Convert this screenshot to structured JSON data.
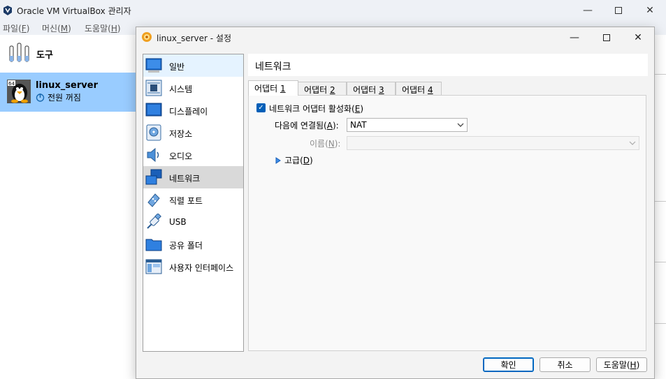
{
  "main_window": {
    "title": "Oracle VM VirtualBox 관리자",
    "menu": [
      "파일",
      "머신",
      "도움말"
    ],
    "menu_keys": [
      "F",
      "M",
      "H"
    ]
  },
  "left_pane": {
    "tools_label": "도구",
    "vm": {
      "name": "linux_server",
      "status": "전원 꺼짐",
      "badge": "64"
    }
  },
  "dialog": {
    "title": "linux_server - 설정",
    "categories": [
      {
        "label": "일반",
        "icon": "monitor-icon"
      },
      {
        "label": "시스템",
        "icon": "chip-icon"
      },
      {
        "label": "디스플레이",
        "icon": "display-icon"
      },
      {
        "label": "저장소",
        "icon": "storage-disk-icon"
      },
      {
        "label": "오디오",
        "icon": "speaker-icon"
      },
      {
        "label": "네트워크",
        "icon": "network-icon"
      },
      {
        "label": "직렬 포트",
        "icon": "serial-port-icon"
      },
      {
        "label": "USB",
        "icon": "usb-icon"
      },
      {
        "label": "공유 폴더",
        "icon": "folder-icon"
      },
      {
        "label": "사용자 인터페이스",
        "icon": "user-interface-icon"
      }
    ],
    "page_title": "네트워크",
    "tabs": [
      {
        "label": "어댑터 ",
        "num": "1"
      },
      {
        "label": "어댑터 ",
        "num": "2"
      },
      {
        "label": "어댑터 ",
        "num": "3"
      },
      {
        "label": "어댑터 ",
        "num": "4"
      }
    ],
    "enable_adapter": {
      "label_pre": "네트워크 어댑터 활성화(",
      "key": "E",
      "label_post": ")",
      "checked": true
    },
    "attached_to": {
      "label_pre": "다음에 연결됨(",
      "key": "A",
      "label_post": "):",
      "value": "NAT"
    },
    "name_field": {
      "label_pre": "이름(",
      "key": "N",
      "label_post": "):",
      "value": ""
    },
    "advanced": {
      "label_pre": "고급(",
      "key": "D",
      "label_post": ")"
    },
    "buttons": {
      "ok": "확인",
      "cancel": "취소",
      "help_pre": "도움말(",
      "help_key": "H",
      "help_post": ")"
    }
  },
  "colors": {
    "selected_vm_bg": "#99ccff",
    "active_category_bg": "#d9d9d9",
    "accent": "#005fb8"
  }
}
